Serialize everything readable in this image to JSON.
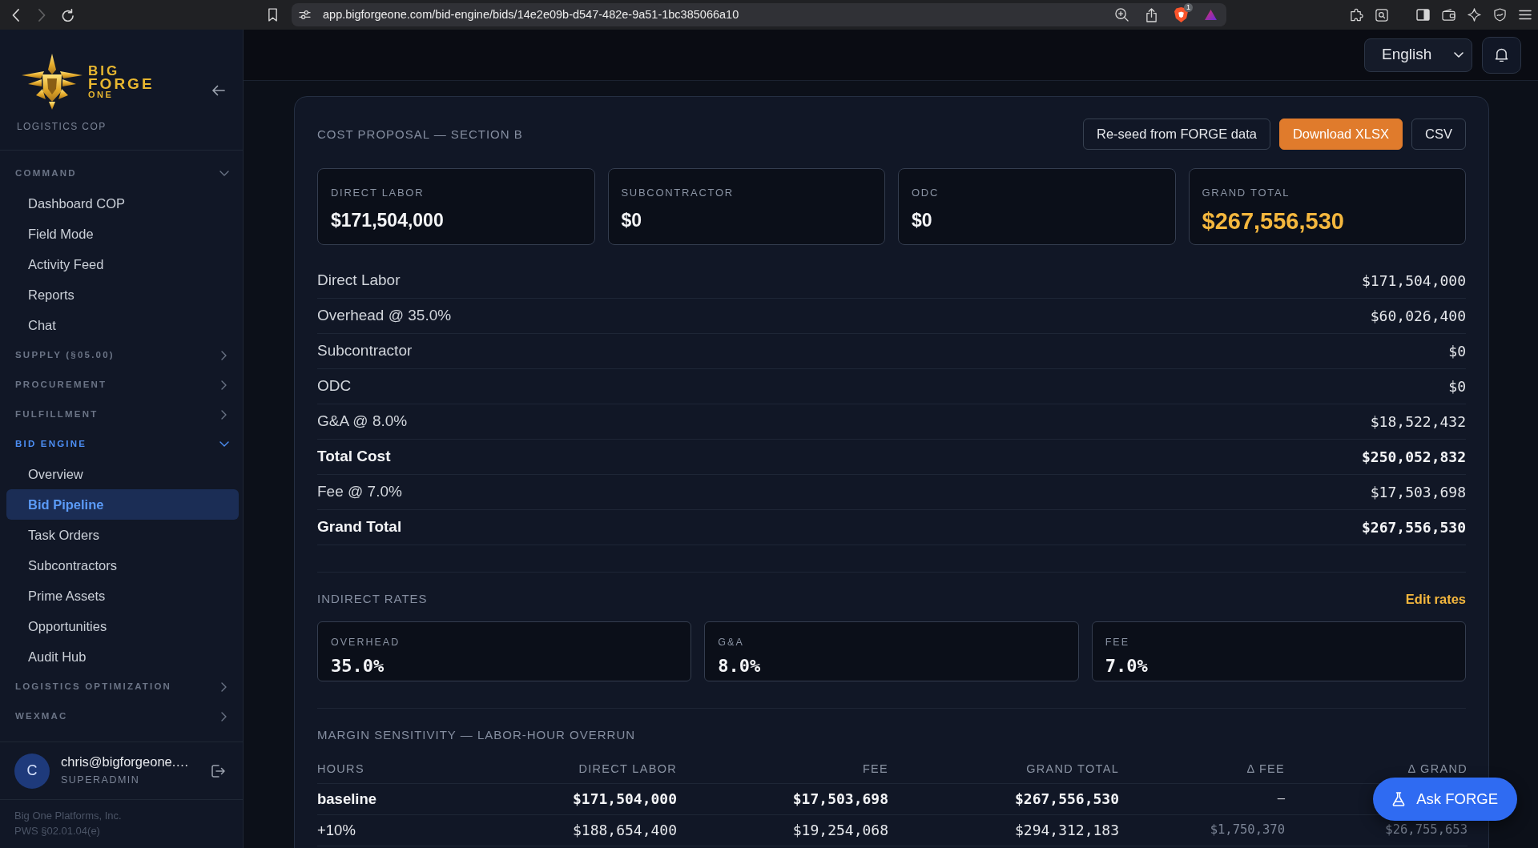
{
  "browser": {
    "can_go_forward": false,
    "url": "app.bigforgeone.com/bid-engine/bids/14e2e09b-d547-482e-9a51-1bc385066a10",
    "extension_badge": "1"
  },
  "sidebar": {
    "wordmark": [
      "BIG",
      "FORGE",
      "ONE"
    ],
    "subtitle": "LOGISTICS COP",
    "sections": [
      {
        "label": "COMMAND",
        "expanded": true,
        "items": [
          {
            "label": "Dashboard COP",
            "selected": false
          },
          {
            "label": "Field Mode",
            "selected": false
          },
          {
            "label": "Activity Feed",
            "selected": false
          },
          {
            "label": "Reports",
            "selected": false
          },
          {
            "label": "Chat",
            "selected": false
          }
        ]
      },
      {
        "label": "SUPPLY (§05.00)",
        "expanded": false
      },
      {
        "label": "PROCUREMENT",
        "expanded": false
      },
      {
        "label": "FULFILLMENT",
        "expanded": false
      },
      {
        "label": "BID ENGINE",
        "expanded": true,
        "items": [
          {
            "label": "Overview",
            "selected": false
          },
          {
            "label": "Bid Pipeline",
            "selected": true
          },
          {
            "label": "Task Orders",
            "selected": false
          },
          {
            "label": "Subcontractors",
            "selected": false
          },
          {
            "label": "Prime Assets",
            "selected": false
          },
          {
            "label": "Opportunities",
            "selected": false
          },
          {
            "label": "Audit Hub",
            "selected": false
          }
        ]
      },
      {
        "label": "LOGISTICS OPTIMIZATION",
        "expanded": false
      },
      {
        "label": "WEXMAC",
        "expanded": false
      }
    ],
    "user": {
      "initial": "C",
      "email": "chris@bigforgeone.…",
      "role": "SUPERADMIN"
    },
    "footer": [
      "Big One Platforms, Inc.",
      "PWS §02.01.04(e)"
    ]
  },
  "topbar": {
    "language": "English"
  },
  "cost_proposal": {
    "title": "COST PROPOSAL — SECTION B",
    "actions": [
      {
        "label": "Re-seed from FORGE data",
        "kind": "secondary"
      },
      {
        "label": "Download XLSX",
        "kind": "primary"
      },
      {
        "label": "CSV",
        "kind": "secondary"
      }
    ],
    "summary": [
      {
        "label": "DIRECT LABOR",
        "value": "$171,504,000",
        "highlight": false
      },
      {
        "label": "SUBCONTRACTOR",
        "value": "$0",
        "highlight": false
      },
      {
        "label": "ODC",
        "value": "$0",
        "highlight": false
      },
      {
        "label": "GRAND TOTAL",
        "value": "$267,556,530",
        "highlight": true
      }
    ],
    "lines": [
      {
        "label": "Direct Labor",
        "value": "$171,504,000",
        "total": false
      },
      {
        "label": "Overhead @ 35.0%",
        "value": "$60,026,400",
        "total": false
      },
      {
        "label": "Subcontractor",
        "value": "$0",
        "total": false
      },
      {
        "label": "ODC",
        "value": "$0",
        "total": false
      },
      {
        "label": "G&A @ 8.0%",
        "value": "$18,522,432",
        "total": false
      },
      {
        "label": "Total Cost",
        "value": "$250,052,832",
        "total": true
      },
      {
        "label": "Fee @ 7.0%",
        "value": "$17,503,698",
        "total": false
      },
      {
        "label": "Grand Total",
        "value": "$267,556,530",
        "total": true
      }
    ]
  },
  "indirect_rates": {
    "title": "INDIRECT RATES",
    "edit_link": "Edit rates",
    "rates": [
      {
        "label": "OVERHEAD",
        "value": "35.0%"
      },
      {
        "label": "G&A",
        "value": "8.0%"
      },
      {
        "label": "FEE",
        "value": "7.0%"
      }
    ]
  },
  "margin_sensitivity": {
    "title": "MARGIN SENSITIVITY — LABOR-HOUR OVERRUN",
    "columns": [
      {
        "label": "HOURS",
        "kind": "label"
      },
      {
        "label": "DIRECT LABOR",
        "kind": "amount"
      },
      {
        "label": "FEE",
        "kind": "amount"
      },
      {
        "label": "GRAND TOTAL",
        "kind": "amount"
      },
      {
        "label": "Δ FEE",
        "kind": "delta"
      },
      {
        "label": "Δ GRAND",
        "kind": "delta"
      }
    ],
    "rows": [
      {
        "emphasized": true,
        "cells": [
          "baseline",
          "$171,504,000",
          "$17,503,698",
          "$267,556,530",
          "–"
        ]
      },
      {
        "emphasized": false,
        "cells": [
          "+10%",
          "$188,654,400",
          "$19,254,068",
          "$294,312,183",
          "$1,750,370",
          "$26,755,653"
        ]
      }
    ]
  },
  "assistant": {
    "label": "Ask FORGE"
  }
}
